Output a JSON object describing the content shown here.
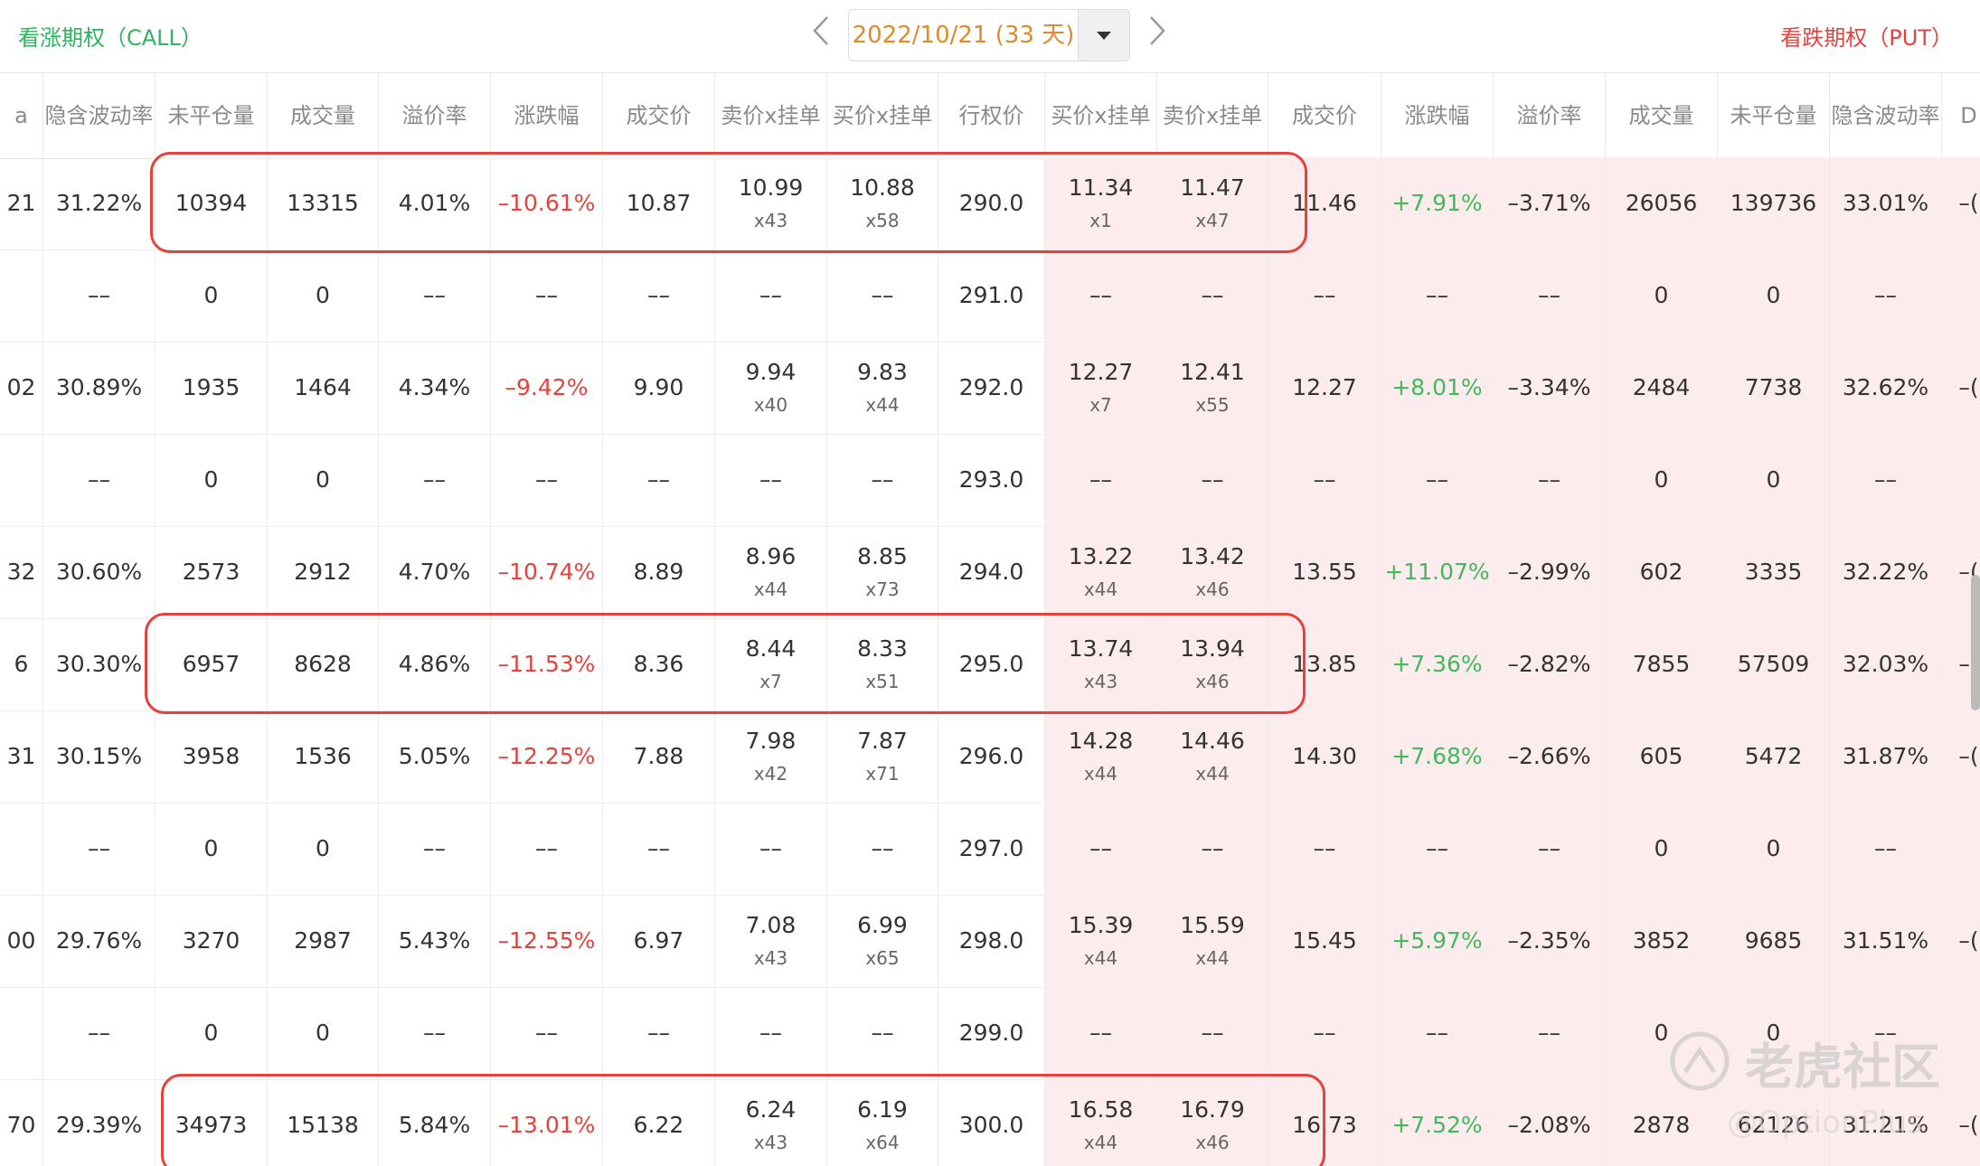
{
  "header": {
    "call_label": "看涨期权（CALL）",
    "put_label": "看跌期权（PUT）",
    "date_label": "2022/10/21 (33 天)",
    "prev_icon": "chevron-left-icon",
    "next_icon": "chevron-right-icon"
  },
  "columns": [
    {
      "key": "c0",
      "l1": "a",
      "l2": ""
    },
    {
      "key": "c_iv",
      "l1": "隐含波动率",
      "l2": ""
    },
    {
      "key": "c_oi",
      "l1": "未平仓量",
      "l2": ""
    },
    {
      "key": "c_vol",
      "l1": "成交量",
      "l2": ""
    },
    {
      "key": "c_prem",
      "l1": "溢价率",
      "l2": ""
    },
    {
      "key": "c_chg",
      "l1": "涨跌幅",
      "l2": ""
    },
    {
      "key": "c_last",
      "l1": "成交价",
      "l2": ""
    },
    {
      "key": "c_ask",
      "l1": "卖价",
      "l2": "x挂单"
    },
    {
      "key": "c_bid",
      "l1": "买价",
      "l2": "x挂单"
    },
    {
      "key": "strike",
      "l1": "行权价",
      "l2": ""
    },
    {
      "key": "p_bid",
      "l1": "买价",
      "l2": "x挂单"
    },
    {
      "key": "p_ask",
      "l1": "卖价",
      "l2": "x挂单"
    },
    {
      "key": "p_last",
      "l1": "成交价",
      "l2": ""
    },
    {
      "key": "p_chg",
      "l1": "涨跌幅",
      "l2": ""
    },
    {
      "key": "p_prem",
      "l1": "溢价率",
      "l2": ""
    },
    {
      "key": "p_vol",
      "l1": "成交量",
      "l2": ""
    },
    {
      "key": "p_oi",
      "l1": "未平仓量",
      "l2": ""
    },
    {
      "key": "p_iv",
      "l1": "隐含波动率",
      "l2": ""
    },
    {
      "key": "p_extra",
      "l1": "D",
      "l2": ""
    }
  ],
  "rows": [
    {
      "c0": "21",
      "c_iv": "31.22%",
      "c_oi": "10394",
      "c_vol": "13315",
      "c_prem": "4.01%",
      "c_chg": "–10.61%",
      "c_last": "10.87",
      "c_ask": "10.99",
      "c_ask_q": "x43",
      "c_bid": "10.88",
      "c_bid_q": "x58",
      "strike": "290.0",
      "p_bid": "11.34",
      "p_bid_q": "x1",
      "p_ask": "11.47",
      "p_ask_q": "x47",
      "p_last": "11.46",
      "p_chg": "+7.91%",
      "p_prem": "–3.71%",
      "p_vol": "26056",
      "p_oi": "139736",
      "p_iv": "33.01%",
      "p_extra": "–("
    },
    {
      "c0": "",
      "c_iv": "––",
      "c_oi": "0",
      "c_vol": "0",
      "c_prem": "––",
      "c_chg": "––",
      "c_last": "––",
      "c_ask": "––",
      "c_ask_q": "",
      "c_bid": "––",
      "c_bid_q": "",
      "strike": "291.0",
      "p_bid": "––",
      "p_bid_q": "",
      "p_ask": "––",
      "p_ask_q": "",
      "p_last": "––",
      "p_chg": "––",
      "p_prem": "––",
      "p_vol": "0",
      "p_oi": "0",
      "p_iv": "––",
      "p_extra": ""
    },
    {
      "c0": "02",
      "c_iv": "30.89%",
      "c_oi": "1935",
      "c_vol": "1464",
      "c_prem": "4.34%",
      "c_chg": "–9.42%",
      "c_last": "9.90",
      "c_ask": "9.94",
      "c_ask_q": "x40",
      "c_bid": "9.83",
      "c_bid_q": "x44",
      "strike": "292.0",
      "p_bid": "12.27",
      "p_bid_q": "x7",
      "p_ask": "12.41",
      "p_ask_q": "x55",
      "p_last": "12.27",
      "p_chg": "+8.01%",
      "p_prem": "–3.34%",
      "p_vol": "2484",
      "p_oi": "7738",
      "p_iv": "32.62%",
      "p_extra": "–("
    },
    {
      "c0": "",
      "c_iv": "––",
      "c_oi": "0",
      "c_vol": "0",
      "c_prem": "––",
      "c_chg": "––",
      "c_last": "––",
      "c_ask": "––",
      "c_ask_q": "",
      "c_bid": "––",
      "c_bid_q": "",
      "strike": "293.0",
      "p_bid": "––",
      "p_bid_q": "",
      "p_ask": "––",
      "p_ask_q": "",
      "p_last": "––",
      "p_chg": "––",
      "p_prem": "––",
      "p_vol": "0",
      "p_oi": "0",
      "p_iv": "––",
      "p_extra": ""
    },
    {
      "c0": "32",
      "c_iv": "30.60%",
      "c_oi": "2573",
      "c_vol": "2912",
      "c_prem": "4.70%",
      "c_chg": "–10.74%",
      "c_last": "8.89",
      "c_ask": "8.96",
      "c_ask_q": "x44",
      "c_bid": "8.85",
      "c_bid_q": "x73",
      "strike": "294.0",
      "p_bid": "13.22",
      "p_bid_q": "x44",
      "p_ask": "13.42",
      "p_ask_q": "x46",
      "p_last": "13.55",
      "p_chg": "+11.07%",
      "p_prem": "–2.99%",
      "p_vol": "602",
      "p_oi": "3335",
      "p_iv": "32.22%",
      "p_extra": "–("
    },
    {
      "c0": "6",
      "c_iv": "30.30%",
      "c_oi": "6957",
      "c_vol": "8628",
      "c_prem": "4.86%",
      "c_chg": "–11.53%",
      "c_last": "8.36",
      "c_ask": "8.44",
      "c_ask_q": "x7",
      "c_bid": "8.33",
      "c_bid_q": "x51",
      "strike": "295.0",
      "p_bid": "13.74",
      "p_bid_q": "x43",
      "p_ask": "13.94",
      "p_ask_q": "x46",
      "p_last": "13.85",
      "p_chg": "+7.36%",
      "p_prem": "–2.82%",
      "p_vol": "7855",
      "p_oi": "57509",
      "p_iv": "32.03%",
      "p_extra": "–("
    },
    {
      "c0": "31",
      "c_iv": "30.15%",
      "c_oi": "3958",
      "c_vol": "1536",
      "c_prem": "5.05%",
      "c_chg": "–12.25%",
      "c_last": "7.88",
      "c_ask": "7.98",
      "c_ask_q": "x42",
      "c_bid": "7.87",
      "c_bid_q": "x71",
      "strike": "296.0",
      "p_bid": "14.28",
      "p_bid_q": "x44",
      "p_ask": "14.46",
      "p_ask_q": "x44",
      "p_last": "14.30",
      "p_chg": "+7.68%",
      "p_prem": "–2.66%",
      "p_vol": "605",
      "p_oi": "5472",
      "p_iv": "31.87%",
      "p_extra": "–("
    },
    {
      "c0": "",
      "c_iv": "––",
      "c_oi": "0",
      "c_vol": "0",
      "c_prem": "––",
      "c_chg": "––",
      "c_last": "––",
      "c_ask": "––",
      "c_ask_q": "",
      "c_bid": "––",
      "c_bid_q": "",
      "strike": "297.0",
      "p_bid": "––",
      "p_bid_q": "",
      "p_ask": "––",
      "p_ask_q": "",
      "p_last": "––",
      "p_chg": "––",
      "p_prem": "––",
      "p_vol": "0",
      "p_oi": "0",
      "p_iv": "––",
      "p_extra": ""
    },
    {
      "c0": "00",
      "c_iv": "29.76%",
      "c_oi": "3270",
      "c_vol": "2987",
      "c_prem": "5.43%",
      "c_chg": "–12.55%",
      "c_last": "6.97",
      "c_ask": "7.08",
      "c_ask_q": "x43",
      "c_bid": "6.99",
      "c_bid_q": "x65",
      "strike": "298.0",
      "p_bid": "15.39",
      "p_bid_q": "x44",
      "p_ask": "15.59",
      "p_ask_q": "x44",
      "p_last": "15.45",
      "p_chg": "+5.97%",
      "p_prem": "–2.35%",
      "p_vol": "3852",
      "p_oi": "9685",
      "p_iv": "31.51%",
      "p_extra": "–("
    },
    {
      "c0": "",
      "c_iv": "––",
      "c_oi": "0",
      "c_vol": "0",
      "c_prem": "––",
      "c_chg": "––",
      "c_last": "––",
      "c_ask": "––",
      "c_ask_q": "",
      "c_bid": "––",
      "c_bid_q": "",
      "strike": "299.0",
      "p_bid": "––",
      "p_bid_q": "",
      "p_ask": "––",
      "p_ask_q": "",
      "p_last": "––",
      "p_chg": "––",
      "p_prem": "––",
      "p_vol": "0",
      "p_oi": "0",
      "p_iv": "––",
      "p_extra": ""
    },
    {
      "c0": "70",
      "c_iv": "29.39%",
      "c_oi": "34973",
      "c_vol": "15138",
      "c_prem": "5.84%",
      "c_chg": "–13.01%",
      "c_last": "6.22",
      "c_ask": "6.24",
      "c_ask_q": "x43",
      "c_bid": "6.19",
      "c_bid_q": "x64",
      "strike": "300.0",
      "p_bid": "16.58",
      "p_bid_q": "x44",
      "p_ask": "16.79",
      "p_ask_q": "x46",
      "p_last": "16.73",
      "p_chg": "+7.52%",
      "p_prem": "–2.08%",
      "p_vol": "2878",
      "p_oi": "62126",
      "p_iv": "31.21%",
      "p_extra": "–("
    }
  ],
  "highlighted_rows": [
    0,
    5,
    10
  ],
  "watermark": {
    "title": "老虎社区",
    "sub": "@OptionPlus",
    "icon": "tiger-logo-icon"
  },
  "colors": {
    "call_green": "#2db55d",
    "put_red": "#e8413b",
    "put_bg": "#fdeced",
    "date_orange": "#e08a2b",
    "highlight": "#e8413b"
  }
}
